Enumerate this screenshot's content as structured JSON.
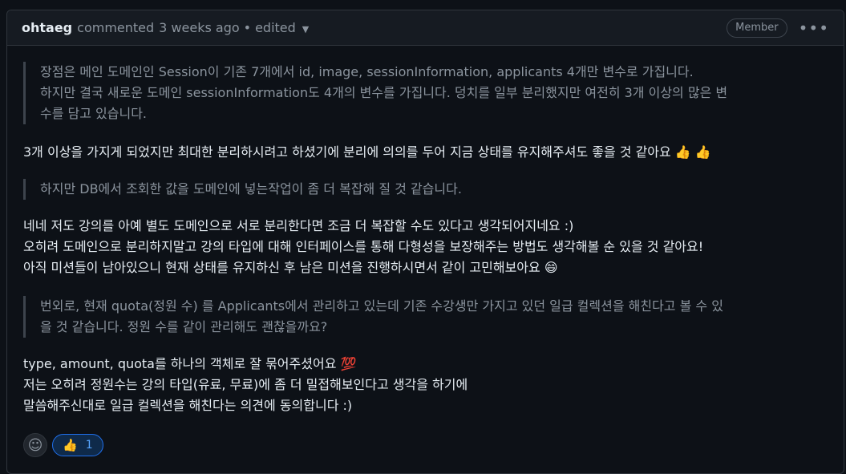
{
  "header": {
    "author": "ohtaeg",
    "action": "commented",
    "time": "3 weeks ago",
    "separator": "•",
    "edited": "edited",
    "role_badge": "Member"
  },
  "quote1": [
    "장점은 메인 도메인인 Session이 기존 7개에서 id, image, sessionInformation, applicants 4개만 변수로 가집니다.",
    "하지만 결국 새로운 도메인 sessionInformation도 4개의 변수를 가집니다. 덩치를 일부 분리했지만 여전히 3개 이상의 많은 변",
    "수를 담고 있습니다."
  ],
  "para1": "3개 이상을 가지게 되었지만 최대한 분리하시려고 하셨기에 분리에 의의를 두어 지금 상태를 유지해주셔도 좋을 것 같아요 👍 👍",
  "quote2": "하지만 DB에서 조회한 값을 도메인에 넣는작업이 좀 더 복잡해 질 것 같습니다.",
  "para2": [
    "네네 저도 강의를 아예 별도 도메인으로 서로 분리한다면 조금 더 복잡할 수도 있다고 생각되어지네요 :)",
    "오히려 도메인으로 분리하지말고 강의 타입에 대해 인터페이스를 통해 다형성을 보장해주는 방법도 생각해볼 순 있을 것 같아요!",
    "아직 미션들이 남아있으니 현재 상태를 유지하신 후 남은 미션을 진행하시면서 같이 고민해보아요 😄"
  ],
  "quote3": [
    "번외로, 현재 quota(정원 수) 를 Applicants에서 관리하고 있는데 기존 수강생만 가지고 있던 일급 컬렉션을 해친다고 볼 수 있",
    "을 것 같습니다. 정원 수를 같이 관리해도 괜찮을까요?"
  ],
  "para3": [
    "type, amount, quota를 하나의 객체로 잘 묶어주셨어요 💯",
    "저는 오히려 정원수는 강의 타입(유료, 무료)에 좀 더 밀접해보인다고 생각을 하기에",
    "말씀해주신대로 일급 컬렉션을 해친다는 의견에 동의합니다 :)"
  ],
  "reactions": {
    "add_icon": "smiley-icon",
    "thumbs_emoji": "👍",
    "thumbs_count": "1"
  }
}
